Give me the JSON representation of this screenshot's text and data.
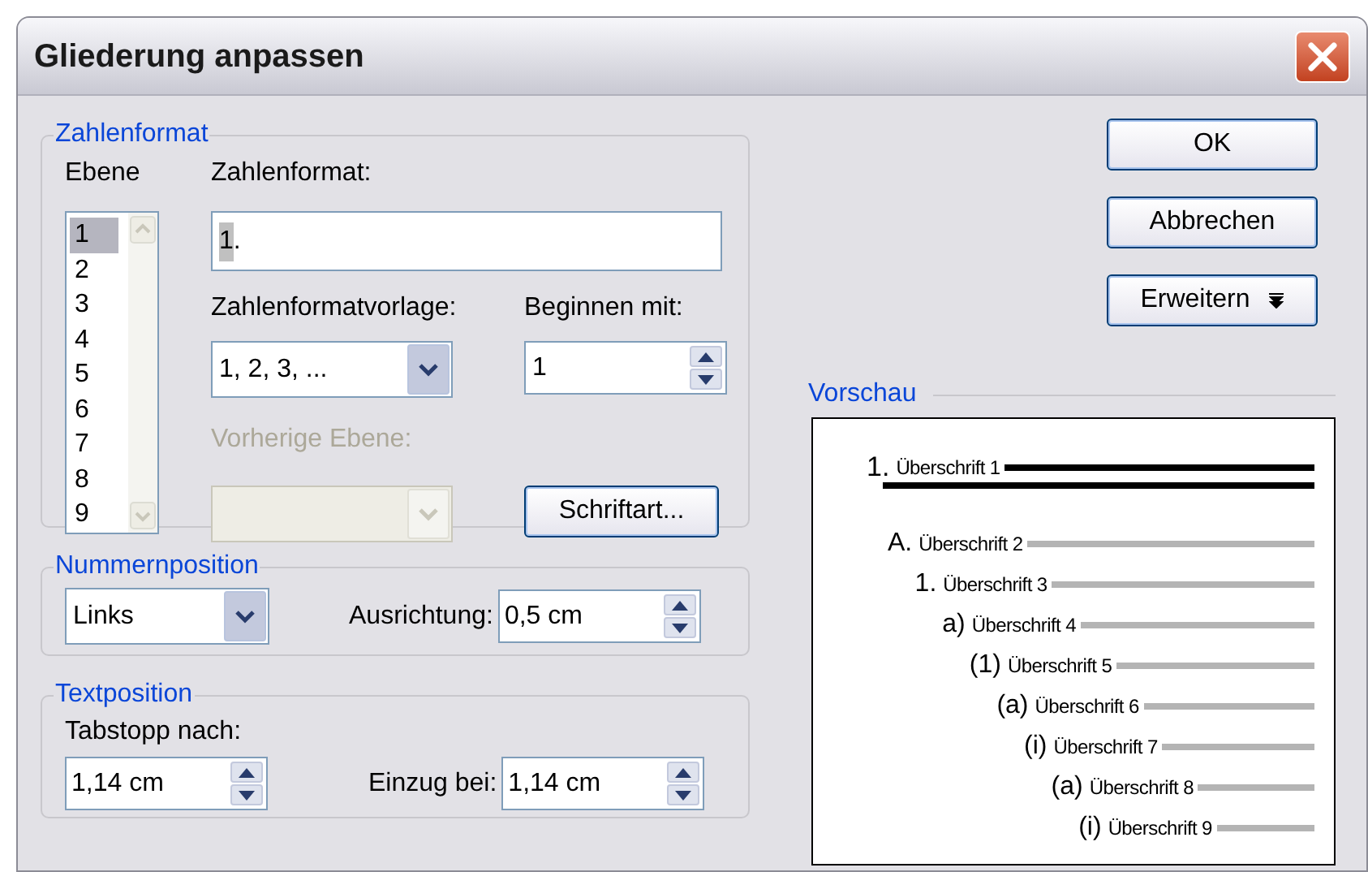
{
  "window": {
    "title": "Gliederung anpassen"
  },
  "number_format_group": {
    "legend": "Zahlenformat",
    "level_list": {
      "label": "Ebene",
      "items": [
        {
          "label": "1",
          "selected": true
        },
        {
          "label": "2",
          "selected": false
        },
        {
          "label": "3",
          "selected": false
        },
        {
          "label": "4",
          "selected": false
        },
        {
          "label": "5",
          "selected": false
        },
        {
          "label": "6",
          "selected": false
        },
        {
          "label": "7",
          "selected": false
        },
        {
          "label": "8",
          "selected": false
        },
        {
          "label": "9",
          "selected": false
        }
      ]
    },
    "number_format": {
      "label": "Zahlenformat:",
      "code": "1",
      "text": "."
    },
    "style": {
      "label": "Zahlenformatvorlage:",
      "value": "1, 2, 3, ..."
    },
    "start_at": {
      "label": "Beginnen mit:",
      "value": "1"
    },
    "previous_level": {
      "label": "Vorherige Ebene:",
      "disabled": true
    },
    "font_button": {
      "label": "Schriftart..."
    }
  },
  "number_position_group": {
    "legend": "Nummernposition",
    "alignment": {
      "value": "Links"
    },
    "aligned_at": {
      "label": "Ausrichtung:",
      "value": "0,5 cm"
    }
  },
  "text_position_group": {
    "legend": "Textposition",
    "tab_after": {
      "label": "Tabstopp nach:",
      "value": "1,14 cm"
    },
    "indent_at": {
      "label": "Einzug bei:",
      "value": "1,14 cm"
    }
  },
  "buttons": [
    {
      "label": "OK",
      "kind": "plain"
    },
    {
      "label": "Abbrechen",
      "kind": "plain"
    },
    {
      "label": "Erweitern",
      "kind": "expand"
    }
  ],
  "preview": {
    "legend": "Vorschau",
    "headings": [
      {
        "number": "1.",
        "text": "Überschrift 1"
      },
      {
        "number": "A.",
        "text": "Überschrift 2"
      },
      {
        "number": "1.",
        "text": "Überschrift 3"
      },
      {
        "number": "a)",
        "text": "Überschrift 4"
      },
      {
        "number": "(1)",
        "text": "Überschrift 5"
      },
      {
        "number": "(a)",
        "text": "Überschrift 6"
      },
      {
        "number": "(i)",
        "text": "Überschrift 7"
      },
      {
        "number": "(a)",
        "text": "Überschrift 8"
      },
      {
        "number": "(i)",
        "text": "Überschrift 9"
      }
    ]
  }
}
